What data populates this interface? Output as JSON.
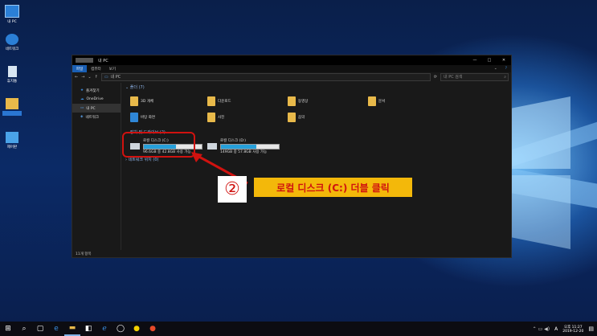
{
  "desktop": {
    "icons": [
      {
        "label": "내 PC",
        "icon": "computer-icon"
      },
      {
        "label": "네트워크",
        "icon": "network-icon"
      },
      {
        "label": "휴지통",
        "icon": "recycle-bin-icon"
      },
      {
        "label": "",
        "icon": "user-folder-icon"
      },
      {
        "label": "제어판",
        "icon": "control-panel-icon"
      }
    ]
  },
  "window": {
    "title": "내 PC",
    "ribbon_tabs": [
      "파일",
      "컴퓨터",
      "보기"
    ],
    "address": "내 PC",
    "search_placeholder": "내 PC 검색",
    "nav_items": [
      "즐겨찾기",
      "OneDrive",
      "내 PC",
      "네트워크"
    ],
    "folders_header": "폴더 (7)",
    "folders": [
      "3D 개체",
      "다운로드",
      "동영상",
      "문서",
      "바탕 화면",
      "사진",
      "음악"
    ],
    "drives_header": "장치 및 드라이브 (2)",
    "drives": [
      {
        "name": "로컬 디스크 (C:)",
        "free_text": "96.6GB 중 42.8GB 사용 가능",
        "used_fraction": 0.56
      },
      {
        "name": "로컬 디스크 (D:)",
        "free_text": "149GB 중 57.8GB 사용 가능",
        "used_fraction": 0.61
      }
    ],
    "network_header": "네트워크 위치 (0)",
    "status": "11개 항목"
  },
  "annotation": {
    "number": "②",
    "text": "로컬 디스크 (C:) 더블 클릭"
  },
  "taskbar": {
    "clock_time": "오후 11:27",
    "clock_date": "2019-12-20",
    "lang": "A",
    "icons": [
      "start-icon",
      "search-icon",
      "task-view-icon",
      "edge-icon",
      "explorer-icon",
      "store-icon",
      "ie-icon",
      "chat-icon",
      "kakao-icon",
      "media-icon"
    ]
  },
  "colors": {
    "accent": "#1a5fb4",
    "highlight": "#d0120f",
    "callout_bg": "#f3b80a"
  }
}
